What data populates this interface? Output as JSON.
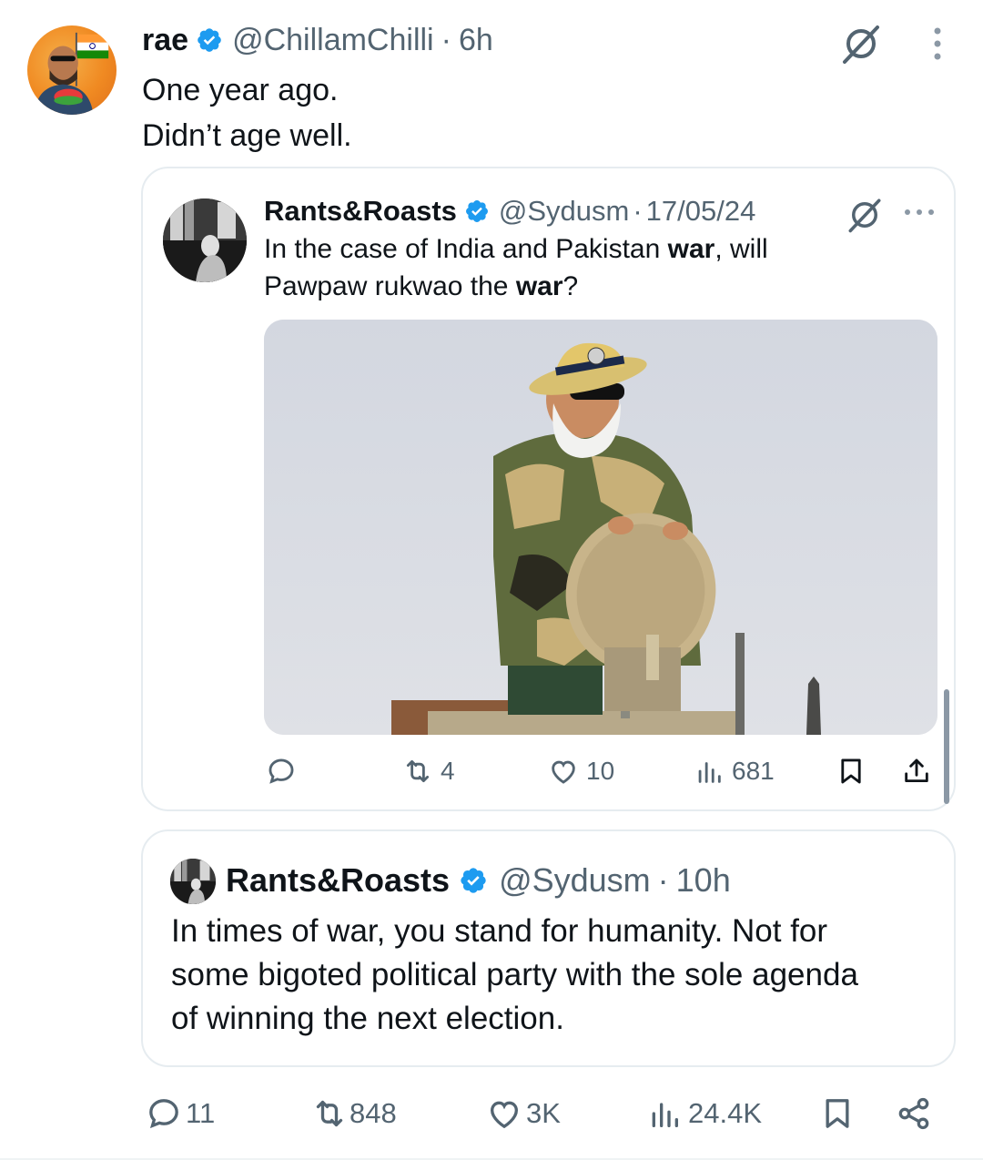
{
  "tweet": {
    "author_name": "rae",
    "handle": "@ChillamChilli",
    "separator": "·",
    "time": "6h",
    "text_lines": [
      "One year ago.",
      "Didn’t age well."
    ],
    "stats": {
      "replies": "11",
      "reposts": "848",
      "likes": "3K",
      "views": "24.4K"
    }
  },
  "quoted_tweet_1": {
    "author_name": "Rants&Roasts",
    "handle": "@Sydusm",
    "separator": "·",
    "date": "17/05/24",
    "text": {
      "line1_a": "In the case of India and Pakistan ",
      "line1_bold": "war",
      "line1_b": ", will",
      "line2_a": "Pawpaw rukwao the ",
      "line2_bold": "war",
      "line2_b": "?"
    },
    "stats": {
      "replies": "",
      "reposts": "4",
      "likes": "10",
      "views": "681"
    }
  },
  "quoted_tweet_2": {
    "author_name": "Rants&Roasts",
    "handle": "@Sydusm",
    "separator": "·",
    "time": "10h",
    "text_lines": [
      "In times of war, you stand for humanity. Not for",
      "some bigoted political party with the sole agenda",
      "of winning the next election."
    ]
  },
  "colors": {
    "text_primary": "#0f1419",
    "text_secondary": "#536471",
    "verified_blue": "#1d9bf0",
    "border": "#e6ecf0"
  },
  "icons": {
    "verified": "verified-badge-icon",
    "grok": "grok-icon",
    "more": "more-icon",
    "reply": "reply-icon",
    "repost": "repost-icon",
    "like": "heart-icon",
    "views": "views-icon",
    "bookmark": "bookmark-icon",
    "share": "share-icon"
  }
}
